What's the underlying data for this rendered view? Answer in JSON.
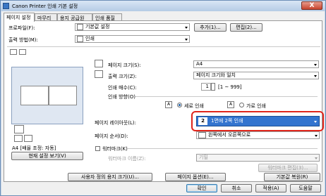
{
  "window": {
    "title": "Canon Printer 인쇄 기본 설정",
    "close_label": "X"
  },
  "tabs": [
    "페이지 설정",
    "마무리",
    "용지 공급원",
    "인쇄 품질"
  ],
  "profile": {
    "label": "프로파일(F):",
    "value": "기본값 설정",
    "add_label": "추가(1)...",
    "edit_label": "편집(2)..."
  },
  "output": {
    "label": "출력 방법(M):",
    "value": "인쇄"
  },
  "page_size": {
    "label": "페이지 크기(S):",
    "value": "A4"
  },
  "output_size": {
    "label": "출력 크기(Z):",
    "value": "페이지 크기와 일치"
  },
  "copies": {
    "label": "인쇄 매수(C):",
    "value": "1",
    "range": "[1 ~ 999]"
  },
  "orientation": {
    "label": "인쇄 방향(O)",
    "portrait_label": "세로 인쇄",
    "landscape_label": "가로 인쇄",
    "portrait_icon": "A",
    "landscape_icon": "A"
  },
  "layout": {
    "label": "페이지 레이아웃(L):",
    "number": "2",
    "value": "1면에 2쪽 인쇄"
  },
  "page_order": {
    "label": "페이지 순서(D):",
    "value": "왼쪽에서 오른쪽으로"
  },
  "watermark": {
    "label": "워터마크(K)",
    "name_label": "워터마크 이름(Z):",
    "name_value": "기밀",
    "edit_label": "워터마크 편집(3)..."
  },
  "preview": {
    "status": "A4 [배율 조정: 자동]",
    "view_label": "현재 설정 보기(V)"
  },
  "bottom_buttons": {
    "custom_size": "사용자 정의 용지 크기(U)...",
    "page_options": "페이지 옵션(E)...",
    "restore": "기본값 복원(R)"
  },
  "dialog_buttons": {
    "ok": "확인",
    "cancel": "취소",
    "apply": "적용(A)",
    "help": "도움말"
  },
  "colors": {
    "highlight": "#e0251b",
    "selection": "#3374cf"
  }
}
